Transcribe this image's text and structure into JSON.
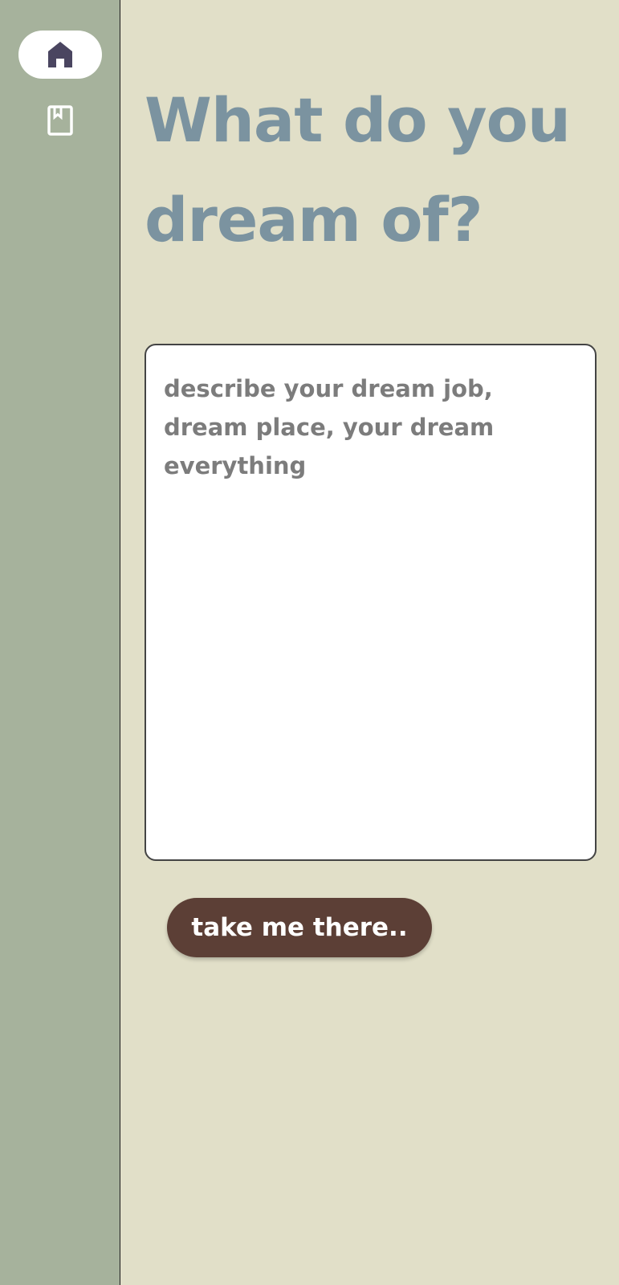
{
  "sidebar": {
    "items": [
      {
        "id": "home",
        "icon": "home-icon",
        "active": true
      },
      {
        "id": "journal",
        "icon": "bookmark-book-icon",
        "active": false
      }
    ]
  },
  "main": {
    "title": "What do you dream of?",
    "input": {
      "value": "",
      "placeholder": "describe your dream job, dream place, your dream everything"
    },
    "submit_label": "take me there.."
  },
  "colors": {
    "background": "#e1dfc8",
    "sidebar": "#a6b29c",
    "title": "#7b93a0",
    "button": "#5c3f36",
    "home_icon": "#4a4560"
  }
}
